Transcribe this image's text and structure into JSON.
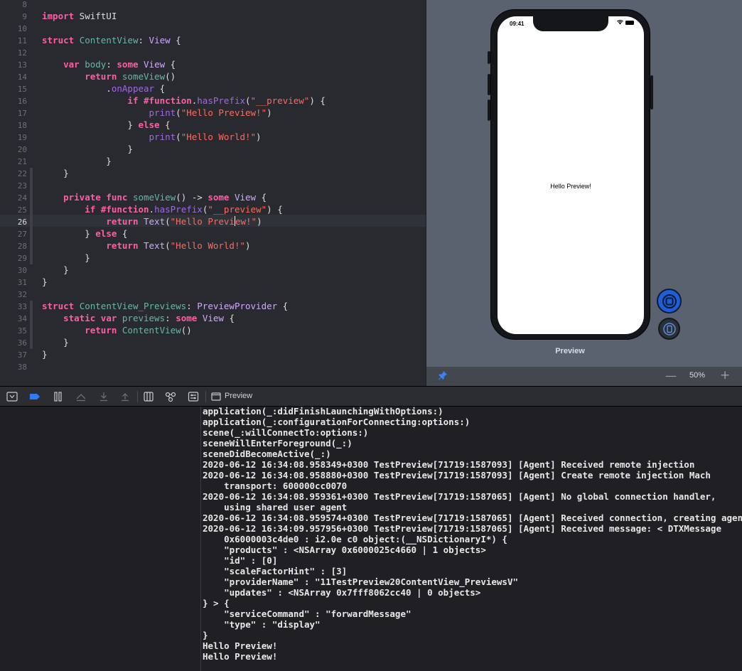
{
  "editor": {
    "line_numbers": [
      "8",
      "9",
      "10",
      "11",
      "12",
      "13",
      "14",
      "15",
      "16",
      "17",
      "18",
      "19",
      "20",
      "21",
      "22",
      "23",
      "24",
      "25",
      "26",
      "27",
      "28",
      "29",
      "30",
      "31",
      "32",
      "33",
      "34",
      "35",
      "36",
      "37",
      "38"
    ],
    "current_line": "26",
    "code_lines": [
      [],
      [
        {
          "t": "import",
          "c": "kw"
        },
        {
          "t": " SwiftUI",
          "c": "pl"
        }
      ],
      [],
      [
        {
          "t": "struct",
          "c": "kw"
        },
        {
          "t": " ",
          "c": "pl"
        },
        {
          "t": "ContentView",
          "c": "fn"
        },
        {
          "t": ": ",
          "c": "pl"
        },
        {
          "t": "View",
          "c": "ty"
        },
        {
          "t": " {",
          "c": "pl"
        }
      ],
      [],
      [
        {
          "t": "    ",
          "c": "pl"
        },
        {
          "t": "var",
          "c": "kw"
        },
        {
          "t": " ",
          "c": "pl"
        },
        {
          "t": "body",
          "c": "fn"
        },
        {
          "t": ": ",
          "c": "pl"
        },
        {
          "t": "some",
          "c": "kw"
        },
        {
          "t": " ",
          "c": "pl"
        },
        {
          "t": "View",
          "c": "ty"
        },
        {
          "t": " {",
          "c": "pl"
        }
      ],
      [
        {
          "t": "        ",
          "c": "pl"
        },
        {
          "t": "return",
          "c": "kw"
        },
        {
          "t": " ",
          "c": "pl"
        },
        {
          "t": "someView",
          "c": "fn"
        },
        {
          "t": "()",
          "c": "pl"
        }
      ],
      [
        {
          "t": "            .",
          "c": "pl"
        },
        {
          "t": "onAppear",
          "c": "md"
        },
        {
          "t": " {",
          "c": "pl"
        }
      ],
      [
        {
          "t": "                ",
          "c": "pl"
        },
        {
          "t": "if",
          "c": "kw"
        },
        {
          "t": " ",
          "c": "pl"
        },
        {
          "t": "#function",
          "c": "kw"
        },
        {
          "t": ".",
          "c": "pl"
        },
        {
          "t": "hasPrefix",
          "c": "md"
        },
        {
          "t": "(",
          "c": "pl"
        },
        {
          "t": "\"__preview\"",
          "c": "st"
        },
        {
          "t": ") {",
          "c": "pl"
        }
      ],
      [
        {
          "t": "                    ",
          "c": "pl"
        },
        {
          "t": "print",
          "c": "md"
        },
        {
          "t": "(",
          "c": "pl"
        },
        {
          "t": "\"Hello Preview!\"",
          "c": "st"
        },
        {
          "t": ")",
          "c": "pl"
        }
      ],
      [
        {
          "t": "                } ",
          "c": "pl"
        },
        {
          "t": "else",
          "c": "kw"
        },
        {
          "t": " {",
          "c": "pl"
        }
      ],
      [
        {
          "t": "                    ",
          "c": "pl"
        },
        {
          "t": "print",
          "c": "md"
        },
        {
          "t": "(",
          "c": "pl"
        },
        {
          "t": "\"Hello World!\"",
          "c": "st"
        },
        {
          "t": ")",
          "c": "pl"
        }
      ],
      [
        {
          "t": "                }",
          "c": "pl"
        }
      ],
      [
        {
          "t": "            }",
          "c": "pl"
        }
      ],
      [
        {
          "t": "    }",
          "c": "pl"
        }
      ],
      [],
      [
        {
          "t": "    ",
          "c": "pl"
        },
        {
          "t": "private",
          "c": "kw"
        },
        {
          "t": " ",
          "c": "pl"
        },
        {
          "t": "func",
          "c": "kw"
        },
        {
          "t": " ",
          "c": "pl"
        },
        {
          "t": "someView",
          "c": "fn"
        },
        {
          "t": "() -> ",
          "c": "pl"
        },
        {
          "t": "some",
          "c": "kw"
        },
        {
          "t": " ",
          "c": "pl"
        },
        {
          "t": "View",
          "c": "ty"
        },
        {
          "t": " {",
          "c": "pl"
        }
      ],
      [
        {
          "t": "        ",
          "c": "pl"
        },
        {
          "t": "if",
          "c": "kw"
        },
        {
          "t": " ",
          "c": "pl"
        },
        {
          "t": "#function",
          "c": "kw"
        },
        {
          "t": ".",
          "c": "pl"
        },
        {
          "t": "hasPrefix",
          "c": "md"
        },
        {
          "t": "(",
          "c": "pl"
        },
        {
          "t": "\"__preview\"",
          "c": "st"
        },
        {
          "t": ") {",
          "c": "pl"
        }
      ],
      [
        {
          "t": "            ",
          "c": "pl"
        },
        {
          "t": "return",
          "c": "kw"
        },
        {
          "t": " ",
          "c": "pl"
        },
        {
          "t": "Text",
          "c": "ty"
        },
        {
          "t": "(",
          "c": "pl"
        },
        {
          "t": "\"Hello Previ",
          "c": "st"
        },
        {
          "t": "|caret|",
          "c": "caret"
        },
        {
          "t": "ew!\"",
          "c": "st"
        },
        {
          "t": ")",
          "c": "pl"
        }
      ],
      [
        {
          "t": "        } ",
          "c": "pl"
        },
        {
          "t": "else",
          "c": "kw"
        },
        {
          "t": " {",
          "c": "pl"
        }
      ],
      [
        {
          "t": "            ",
          "c": "pl"
        },
        {
          "t": "return",
          "c": "kw"
        },
        {
          "t": " ",
          "c": "pl"
        },
        {
          "t": "Text",
          "c": "ty"
        },
        {
          "t": "(",
          "c": "pl"
        },
        {
          "t": "\"Hello World!\"",
          "c": "st"
        },
        {
          "t": ")",
          "c": "pl"
        }
      ],
      [
        {
          "t": "        }",
          "c": "pl"
        }
      ],
      [
        {
          "t": "    }",
          "c": "pl"
        }
      ],
      [
        {
          "t": "}",
          "c": "pl"
        }
      ],
      [],
      [
        {
          "t": "struct",
          "c": "kw"
        },
        {
          "t": " ",
          "c": "pl"
        },
        {
          "t": "ContentView_Previews",
          "c": "fn"
        },
        {
          "t": ": ",
          "c": "pl"
        },
        {
          "t": "PreviewProvider",
          "c": "ty"
        },
        {
          "t": " {",
          "c": "pl"
        }
      ],
      [
        {
          "t": "    ",
          "c": "pl"
        },
        {
          "t": "static",
          "c": "kw"
        },
        {
          "t": " ",
          "c": "pl"
        },
        {
          "t": "var",
          "c": "kw"
        },
        {
          "t": " ",
          "c": "pl"
        },
        {
          "t": "previews",
          "c": "fn"
        },
        {
          "t": ": ",
          "c": "pl"
        },
        {
          "t": "some",
          "c": "kw"
        },
        {
          "t": " ",
          "c": "pl"
        },
        {
          "t": "View",
          "c": "ty"
        },
        {
          "t": " {",
          "c": "pl"
        }
      ],
      [
        {
          "t": "        ",
          "c": "pl"
        },
        {
          "t": "return",
          "c": "kw"
        },
        {
          "t": " ",
          "c": "pl"
        },
        {
          "t": "ContentView",
          "c": "fn"
        },
        {
          "t": "()",
          "c": "pl"
        }
      ],
      [
        {
          "t": "    }",
          "c": "pl"
        }
      ],
      [
        {
          "t": "}",
          "c": "pl"
        }
      ],
      []
    ]
  },
  "preview": {
    "status_time": "09:41",
    "screen_text": "Hello Preview!",
    "label": "Preview",
    "zoom": "50%",
    "zoom_minus": "—",
    "zoom_plus": "+"
  },
  "debug_toolbar": {
    "preview_tab": "Preview"
  },
  "console": {
    "lines": [
      "application(_:didFinishLaunchingWithOptions:)",
      "application(_:configurationForConnecting:options:)",
      "scene(_:willConnectTo:options:)",
      "sceneWillEnterForeground(_:)",
      "sceneDidBecomeActive(_:)",
      "2020-06-12 16:34:08.958349+0300 TestPreview[71719:1587093] [Agent] Received remote injection",
      "2020-06-12 16:34:08.958880+0300 TestPreview[71719:1587093] [Agent] Create remote injection Mach",
      "    transport: 600000cc0070",
      "2020-06-12 16:34:08.959361+0300 TestPreview[71719:1587065] [Agent] No global connection handler,",
      "    using shared user agent",
      "2020-06-12 16:34:08.959574+0300 TestPreview[71719:1587065] [Agent] Received connection, creating agent",
      "2020-06-12 16:34:09.957956+0300 TestPreview[71719:1587065] [Agent] Received message: < DTXMessage",
      "    0x6000003c4de0 : i2.0e c0 object:(__NSDictionaryI*) {",
      "    \"products\" : <NSArray 0x6000025c4660 | 1 objects>",
      "    \"id\" : [0]",
      "    \"scaleFactorHint\" : [3]",
      "    \"providerName\" : \"11TestPreview20ContentView_PreviewsV\"",
      "    \"updates\" : <NSArray 0x7fff8062cc40 | 0 objects>",
      "} > {",
      "    \"serviceCommand\" : \"forwardMessage\"",
      "    \"type\" : \"display\"",
      "}",
      "Hello Preview!",
      "Hello Preview!"
    ]
  }
}
